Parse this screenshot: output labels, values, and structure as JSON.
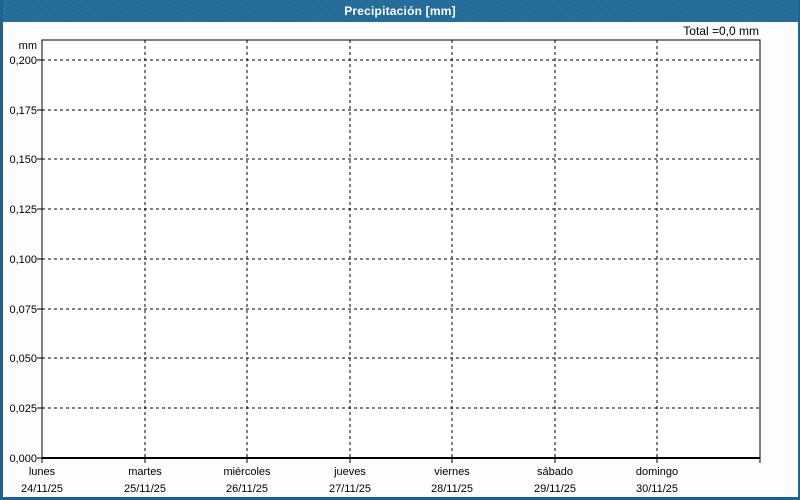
{
  "window": {
    "title": "Precipitación [mm]"
  },
  "header": {
    "total_label": "Total =0,0 mm"
  },
  "colors": {
    "titlebar": "#266d9c",
    "titlebar_text": "#ffffff",
    "window_border": "#1d6290",
    "window_background": "#fcfdfc",
    "plot_background": "#ffffff",
    "axis": "#000000",
    "grid": "#000000",
    "text": "#000000"
  },
  "chart_data": {
    "type": "bar",
    "title": "Precipitación [mm]",
    "total_label": "Total =0,0 mm",
    "total_mm": 0.0,
    "ylabel": "mm",
    "ylim": [
      0,
      0.21
    ],
    "grid": true,
    "y_axis": {
      "unit": "mm",
      "ticks": [
        {
          "label": "0,200",
          "value": 0.2
        },
        {
          "label": "0,175",
          "value": 0.175
        },
        {
          "label": "0,150",
          "value": 0.15
        },
        {
          "label": "0,125",
          "value": 0.125
        },
        {
          "label": "0,100",
          "value": 0.1
        },
        {
          "label": "0,075",
          "value": 0.075
        },
        {
          "label": "0,050",
          "value": 0.05
        },
        {
          "label": "0,025",
          "value": 0.025
        },
        {
          "label": "0,000",
          "value": 0.0
        }
      ]
    },
    "x_axis": {
      "categories": [
        {
          "day": "lunes",
          "date": "24/11/25"
        },
        {
          "day": "martes",
          "date": "25/11/25"
        },
        {
          "day": "miércoles",
          "date": "26/11/25"
        },
        {
          "day": "jueves",
          "date": "27/11/25"
        },
        {
          "day": "viernes",
          "date": "28/11/25"
        },
        {
          "day": "sábado",
          "date": "29/11/25"
        },
        {
          "day": "domingo",
          "date": "30/11/25"
        }
      ]
    },
    "series": [
      {
        "name": "Precipitación",
        "values": [
          0,
          0,
          0,
          0,
          0,
          0,
          0
        ]
      }
    ]
  }
}
